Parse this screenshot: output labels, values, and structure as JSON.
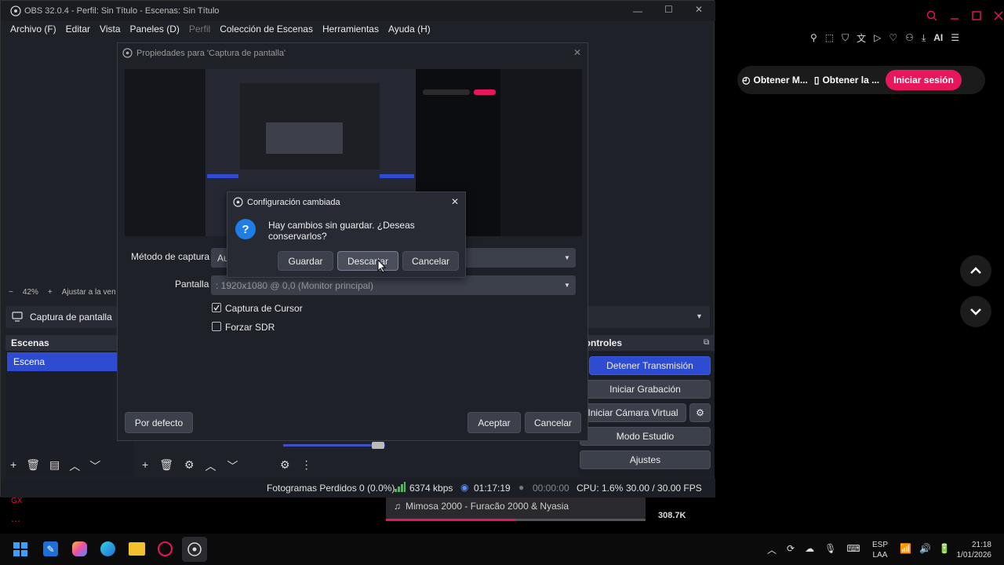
{
  "obs": {
    "title": "OBS 32.0.4 - Perfil: Sin Título - Escenas: Sin Título",
    "menu": [
      "Archivo (F)",
      "Editar",
      "Vista",
      "Paneles (D)",
      "Perfil",
      "Colección de Escenas",
      "Herramientas",
      "Ayuda (H)"
    ],
    "zoom": "42%",
    "fit_label": "Ajustar a la ven",
    "source_name": "Captura de pantalla",
    "scenes_header": "Escenas",
    "scene_item": "Escena",
    "controls_header": "Controles",
    "controls": {
      "stop_stream": "Detener Transmisión",
      "start_record": "Iniciar Grabación",
      "virtual_cam": "Iniciar Cámara Virtual",
      "studio_mode": "Modo Estudio",
      "settings": "Ajustes"
    },
    "status": {
      "dropped": "Fotogramas Perdidos 0 (0.0%)",
      "bitrate": "6374 kbps",
      "stream_time": "01:17:19",
      "rec_time": "00:00:00",
      "cpu": "CPU: 1.6%",
      "fps": "30.00 / 30.00 FPS"
    }
  },
  "props": {
    "title": "Propiedades para 'Captura de pantalla'",
    "capture_method_label": "Método de captura",
    "capture_method_value": "Au",
    "screen_label": "Pantalla",
    "screen_value": ": 1920x1080 @ 0,0 (Monitor principal)",
    "capture_cursor": "Captura de Cursor",
    "force_sdr": "Forzar SDR",
    "defaults": "Por defecto",
    "accept": "Aceptar",
    "cancel": "Cancelar"
  },
  "dialog": {
    "title": "Configuración cambiada",
    "message": "Hay cambios sin guardar. ¿Deseas conservarlos?",
    "save": "Guardar",
    "discard": "Descartar",
    "cancel": "Cancelar"
  },
  "browser": {
    "pill1": "Obtener M...",
    "pill2": "Obtener la ...",
    "login": "Iniciar sesión",
    "ai_label": "AI",
    "music": "Mimosa 2000 - Furacão 2000 & Nyasia",
    "count": "308.7K",
    "gx": "GX",
    "accent": "#e8175d"
  },
  "taskbar": {
    "lang": "ESP",
    "layout": "LAA",
    "time": "21:18",
    "date": "1/01/2026"
  }
}
